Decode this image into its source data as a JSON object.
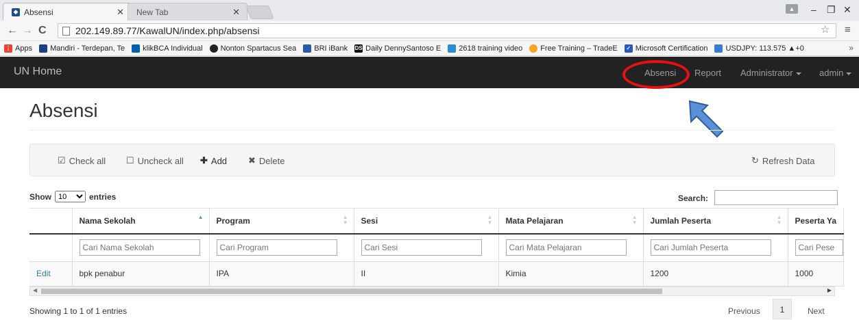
{
  "browser": {
    "tabs": [
      {
        "title": "Absensi",
        "active": true
      },
      {
        "title": "New Tab",
        "active": false
      }
    ],
    "url": "202.149.89.77/KawalUN/index.php/absensi",
    "bookmarks": [
      {
        "label": "Apps",
        "color": "#ea4335"
      },
      {
        "label": "Mandiri - Terdepan, Te",
        "color": "#1b3f8b"
      },
      {
        "label": "klikBCA Individual",
        "color": "#0060af"
      },
      {
        "label": "Nonton Spartacus Sea",
        "color": "#222222"
      },
      {
        "label": "BRI iBank",
        "color": "#2b5aa8"
      },
      {
        "label": "Daily DennySantoso E",
        "color": "#111111"
      },
      {
        "label": "2618 training video",
        "color": "#2d8bd8"
      },
      {
        "label": "Free Training – TradeE",
        "color": "#f5a623"
      },
      {
        "label": "Microsoft Certification",
        "color": "#2a56c6"
      },
      {
        "label": "USDJPY: 113.575 ▲+0",
        "color": "#3b7bd0"
      }
    ],
    "more_label": "»"
  },
  "navbar": {
    "brand": "UN Home",
    "links": {
      "absensi": "Absensi",
      "report": "Report",
      "administrator": "Administrator",
      "admin": "admin"
    }
  },
  "page": {
    "title": "Absensi"
  },
  "toolbar": {
    "check_all": "Check all",
    "uncheck_all": "Uncheck all",
    "add": "Add",
    "delete": "Delete",
    "refresh": "Refresh Data"
  },
  "table_controls": {
    "show_prefix": "Show",
    "show_value": "10",
    "show_suffix": "entries",
    "search_label": "Search:"
  },
  "table": {
    "columns": [
      "Nama Sekolah",
      "Program",
      "Sesi",
      "Mata Pelajaran",
      "Jumlah Peserta",
      "Peserta Ya"
    ],
    "filters": [
      "Cari Nama Sekolah",
      "Cari Program",
      "Cari Sesi",
      "Cari Mata Pelajaran",
      "Cari Jumlah Peserta",
      "Cari Pese"
    ],
    "rows": [
      {
        "action": "Edit",
        "cells": [
          "bpk penabur",
          "IPA",
          "II",
          "Kimia",
          "1200",
          "1000"
        ]
      }
    ]
  },
  "footer": {
    "info": "Showing 1 to 1 of 1 entries",
    "previous": "Previous",
    "current_page": "1",
    "next": "Next"
  }
}
